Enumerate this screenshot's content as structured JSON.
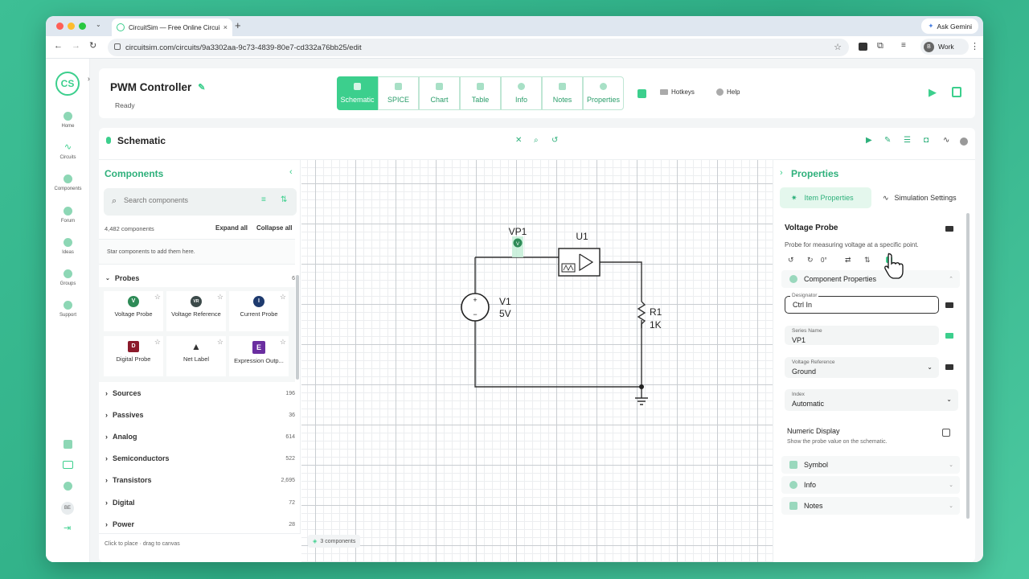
{
  "browser": {
    "tab_title": "CircuitSim — Free Online Circuit Simulator",
    "new_tab": "+",
    "url": "circuitsim.com/circuits/9a3302aa-9c73-4839-80e7-cd332a76bb25/edit",
    "ask_gemini": "Ask Gemini",
    "profile_initial": "B",
    "profile_label": "Work"
  },
  "rail": {
    "items": [
      {
        "label": "Home"
      },
      {
        "label": "Circuits"
      },
      {
        "label": "Components"
      },
      {
        "label": "Forum"
      },
      {
        "label": "Ideas"
      },
      {
        "label": "Groups"
      },
      {
        "label": "Support"
      }
    ],
    "user_initials": "BE"
  },
  "header": {
    "project_name": "PWM Controller",
    "status": "Ready",
    "tabs": [
      {
        "label": "Schematic",
        "active": true
      },
      {
        "label": "SPICE"
      },
      {
        "label": "Chart"
      },
      {
        "label": "Table"
      },
      {
        "label": "Info"
      },
      {
        "label": "Notes"
      },
      {
        "label": "Properties"
      }
    ],
    "hotkeys": "Hotkeys",
    "help": "Help"
  },
  "schematic": {
    "title": "Schematic",
    "component_count": "3 components"
  },
  "components_panel": {
    "title": "Components",
    "search_placeholder": "Search components",
    "count": "4,482 components",
    "expand_all": "Expand all",
    "collapse_all": "Collapse all",
    "star_hint": "Star components to add them here.",
    "probes": {
      "name": "Probes",
      "count": "6",
      "items": [
        {
          "label": "Voltage Probe",
          "glyph": "V",
          "color": "#2e8b57"
        },
        {
          "label": "Voltage Reference",
          "glyph": "VR",
          "color": "#3c4a4a"
        },
        {
          "label": "Current Probe",
          "glyph": "I",
          "color": "#1e3a6e"
        },
        {
          "label": "Digital Probe",
          "glyph": "D",
          "color": "#8b1a2b"
        },
        {
          "label": "Net Label",
          "glyph": "▲",
          "color": "#333333"
        },
        {
          "label": "Expression Outp...",
          "glyph": "E",
          "color": "#6a2ea0"
        }
      ]
    },
    "categories": [
      {
        "name": "Sources",
        "count": "196"
      },
      {
        "name": "Passives",
        "count": "36"
      },
      {
        "name": "Analog",
        "count": "614"
      },
      {
        "name": "Semiconductors",
        "count": "522"
      },
      {
        "name": "Transistors",
        "count": "2,695"
      },
      {
        "name": "Digital",
        "count": "72"
      },
      {
        "name": "Power",
        "count": "28"
      }
    ],
    "footer": "Click to place · drag to canvas"
  },
  "circuit": {
    "probe_label": "VP1",
    "probe_glyph": "V",
    "u1": "U1",
    "v1_name": "V1",
    "v1_value": "5V",
    "plus": "+",
    "minus": "−",
    "r1_name": "R1",
    "r1_value": "1K"
  },
  "properties": {
    "title": "Properties",
    "tab_item": "Item Properties",
    "tab_sim": "Simulation Settings",
    "item_title": "Voltage Probe",
    "item_desc": "Probe for measuring voltage at a specific point.",
    "rotation": "0°",
    "component_properties": "Component Properties",
    "designator_label": "Designator",
    "designator_value": "Ctrl In",
    "series_label": "Series Name",
    "series_value": "VP1",
    "vref_label": "Voltage Reference",
    "vref_value": "Ground",
    "index_label": "Index",
    "index_value": "Automatic",
    "numeric_title": "Numeric Display",
    "numeric_desc": "Show the probe value on the schematic.",
    "sections": [
      {
        "label": "Symbol"
      },
      {
        "label": "Info"
      },
      {
        "label": "Notes"
      }
    ]
  },
  "colors": {
    "accent": "#3ccf8d",
    "accent_dark": "#2eb07b",
    "background": "#3dbf95"
  }
}
